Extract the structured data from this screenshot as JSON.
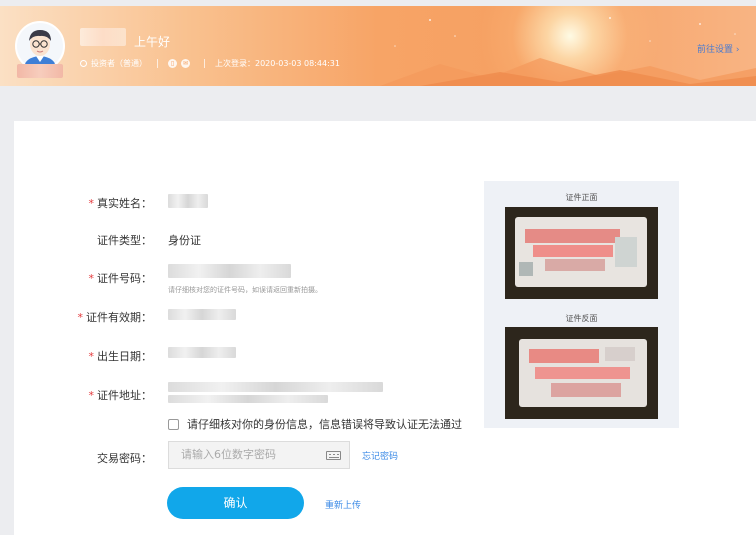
{
  "header": {
    "greeting": "上午好",
    "role": "投资者（普通）",
    "last_login": "上次登录：2020-03-03 08:44:31",
    "goto_settings": "前往设置"
  },
  "form": {
    "real_name_label": "真实姓名：",
    "id_type_label": "证件类型：",
    "id_type_value": "身份证",
    "id_number_label": "证件号码：",
    "id_number_hint": "请仔细核对您的证件号码，如误请返回重新拍摄。",
    "validity_label": "证件有效期：",
    "birth_label": "出生日期：",
    "address_label": "证件地址：",
    "confirm_check_text": "请仔细核对你的身份信息，信息错误将导致认证无法通过",
    "password_label": "交易密码：",
    "password_placeholder": "请输入6位数字密码",
    "forgot_password": "忘记密码",
    "confirm_button": "确认",
    "reupload": "重新上传"
  },
  "id_panel": {
    "front_title": "证件正面",
    "back_title": "证件反面"
  },
  "colors": {
    "accent_blue": "#11a7ea",
    "link_blue": "#3b8ae6",
    "required_red": "#e4393c",
    "banner_orange": "#f7a466"
  },
  "icons": [
    "avatar-icon",
    "user-role-icon",
    "phone-icon",
    "email-icon",
    "chevron-right-icon",
    "keyboard-icon",
    "checkbox-icon"
  ]
}
